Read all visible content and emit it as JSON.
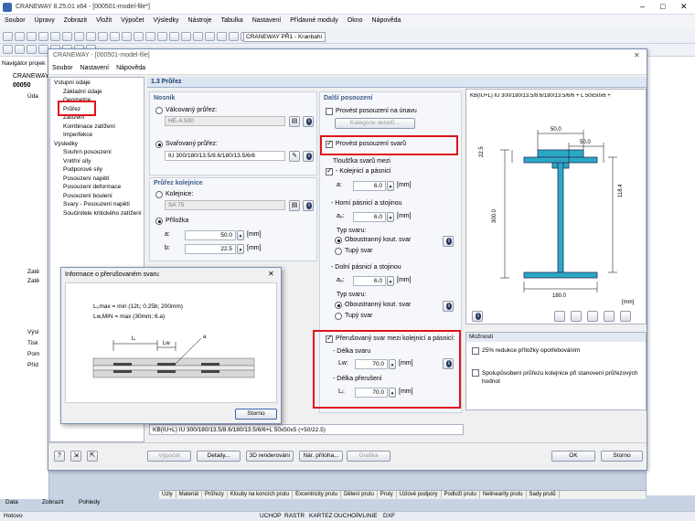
{
  "app": {
    "title": "CRANEWAY 8.25.01 x64 - [000501-model-file*]"
  },
  "menu": [
    "Soubor",
    "Úpravy",
    "Zobrazit",
    "Vložit",
    "Výpočet",
    "Výsledky",
    "Nástroje",
    "Tabulka",
    "Nastavení",
    "Přídavné moduly",
    "Okno",
    "Nápověda"
  ],
  "toolbar": {
    "case_select": "CRANEWAY PŘ1 - Kranbahi"
  },
  "nav": {
    "title": "Navigátor projek",
    "root": "CRANEWAY",
    "model": "00050",
    "items": [
      "Úda",
      "Zatě",
      "Zatě",
      "Výsl",
      "Tisk",
      "Pom",
      "Příd"
    ]
  },
  "dialog": {
    "title": "CRANEWAY - [000501-model-file]",
    "menu": [
      "Soubor",
      "Nastavení",
      "Nápověda"
    ],
    "tree": {
      "input_header": "Vstupní údaje",
      "input_items": [
        "Základní údaje",
        "Geometrie",
        "Průřez",
        "Zatížení",
        "Kombinace zatížení",
        "Imperfekce"
      ],
      "results_header": "Výsledky",
      "results_items": [
        "Souhrn posouzení",
        "Vnitřní síly",
        "Podporové síly",
        "Posouzení napětí",
        "Posouzení deformace",
        "Posouzení boulení",
        "Svary - Posouzení napětí",
        "Součinitele kritického zatížení"
      ]
    },
    "page_title": "1.3 Průřez",
    "nosnik": {
      "header": "Nosník",
      "rolled_label": "Válcovaný průřez:",
      "rolled_value": "HE-A 500",
      "welded_label": "Svařovaný průřez:",
      "welded_value": "IU 300/180/13.5/8.6/180/13.5/6/6"
    },
    "rail": {
      "header": "Průřez kolejnice",
      "rail_label": "Kolejnice:",
      "rail_value": "SA 75",
      "plate_label": "Příložka",
      "a_label": "a:",
      "a_value": "50.0",
      "b_label": "b:",
      "b_value": "22.5",
      "unit": "[mm]"
    },
    "further": {
      "header": "Další posouzení",
      "fatigue_label": "Provést posouzení na únavu",
      "fatigue_button": "Kategorie detailů...",
      "welds_label": "Provést posouzení svarů",
      "thickness_label": "Tloušťka svarů mezi",
      "rail_flange_label": "- Kolejnicí a pásnicí",
      "a_label": "a:",
      "a_value": "6.0",
      "upper_label": "- Horní pásnicí a stojinou",
      "ao_label": "aₒ:",
      "ao_value": "6.0",
      "type_label": "Typ svaru:",
      "double_fillet": "Oboustranný kout. svar",
      "blunt": "Tupý svar",
      "lower_label": "- Dolní pásnicí a stojinou",
      "au_label": "aᵤ:",
      "au_value": "6.0",
      "type2_label": "Typ svaru:",
      "double_fillet2": "Oboustranný kout. svar",
      "blunt2": "Tupý svar",
      "intermittent_label": "Přerušovaný svar mezi kolejnicí a pásnicí:",
      "weld_length_label": "- Délka svaru",
      "lw_label": "Lw:",
      "lw_value": "70.0",
      "break_length_label": "- Délka přerušení",
      "li_label": "Lᵢ:",
      "li_value": "70.0",
      "unit": "[mm]"
    },
    "preview": {
      "caption": "KB(IU+L) IU 300/180/13.5/8.6/180/13.5/6/6 + L 50x50x6 +",
      "dims": [
        "50.0",
        "50.0",
        "22.5",
        "118.4",
        "300.0",
        "180.0"
      ],
      "unit": "[mm]"
    },
    "options": {
      "header": "Možnosti",
      "opt1": "25% redukce příložky opotřebováním",
      "opt2": "Spolupůsobení průřezu kolejnice při stanovení průřezových hodnot"
    },
    "bottom_caption": "KB(IU+L) IU 300/180/13.5/8.6/180/13.5/6/6+L 50x50x5 (+50/22.5)",
    "buttons": {
      "calc": "Výpočet",
      "details": "Detaily...",
      "render": "3D renderování",
      "attachment": "Nár. příloha...",
      "graphics": "Grafika",
      "ok": "OK",
      "cancel": "Storno"
    }
  },
  "popup": {
    "title": "Informace o přerušovaném svaru",
    "formula1": "Lᵢ,max = min (12tᵢ; 0.25b; 200mm)",
    "formula2": "Lw,MIN = max (30mm; 6.a)",
    "labels": {
      "li": "Lᵢ",
      "lw": "Lw",
      "a": "a"
    },
    "cancel": "Storno"
  },
  "bottom_tabs": [
    "Uzly",
    "Materiál",
    "Průřezy",
    "Klouby na koncích prutu",
    "Excentricity prutu",
    "Dělení prutu",
    "Pruty",
    "Uzlové podpory",
    "Podloží prutu",
    "Nelinearity prutu",
    "Sady prutů"
  ],
  "nav_tabs": [
    "Data",
    "Zobrazit",
    "Pohledy"
  ],
  "status": {
    "left": "Hotovo",
    "cells": [
      "UCHOP",
      "RASTR",
      "KARTEZ",
      "OUCHOP",
      "VLINIE",
      "DXF"
    ]
  },
  "colors": {
    "accent": "#1e3a6e",
    "highlight": "#e0131b",
    "section": "#2aa9c2"
  }
}
